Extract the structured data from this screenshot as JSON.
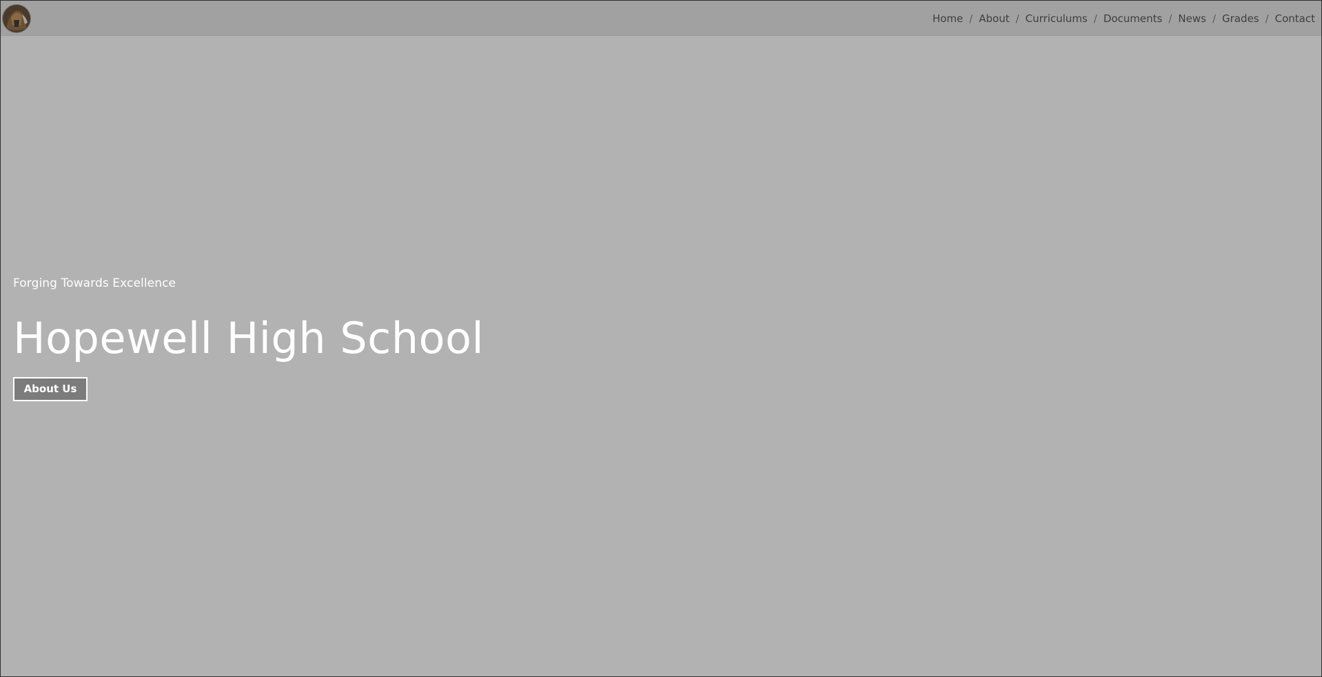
{
  "site": {
    "logo_icon": "school-crest-logo"
  },
  "nav": {
    "items": [
      {
        "label": "Home"
      },
      {
        "label": "About"
      },
      {
        "label": "Curriculums"
      },
      {
        "label": "Documents"
      },
      {
        "label": "News"
      },
      {
        "label": "Grades"
      },
      {
        "label": "Contact"
      }
    ],
    "separator": "/"
  },
  "hero": {
    "tagline": "Forging Towards Excellence",
    "title": "Hopewell High School",
    "cta_label": "About Us"
  },
  "colors": {
    "page_background": "#b2b2b2",
    "topbar_background": "#a1a1a1",
    "nav_text": "#3e3e3e",
    "hero_text": "#ffffff",
    "button_background": "#7c7c7c",
    "button_border": "#ffffff"
  }
}
